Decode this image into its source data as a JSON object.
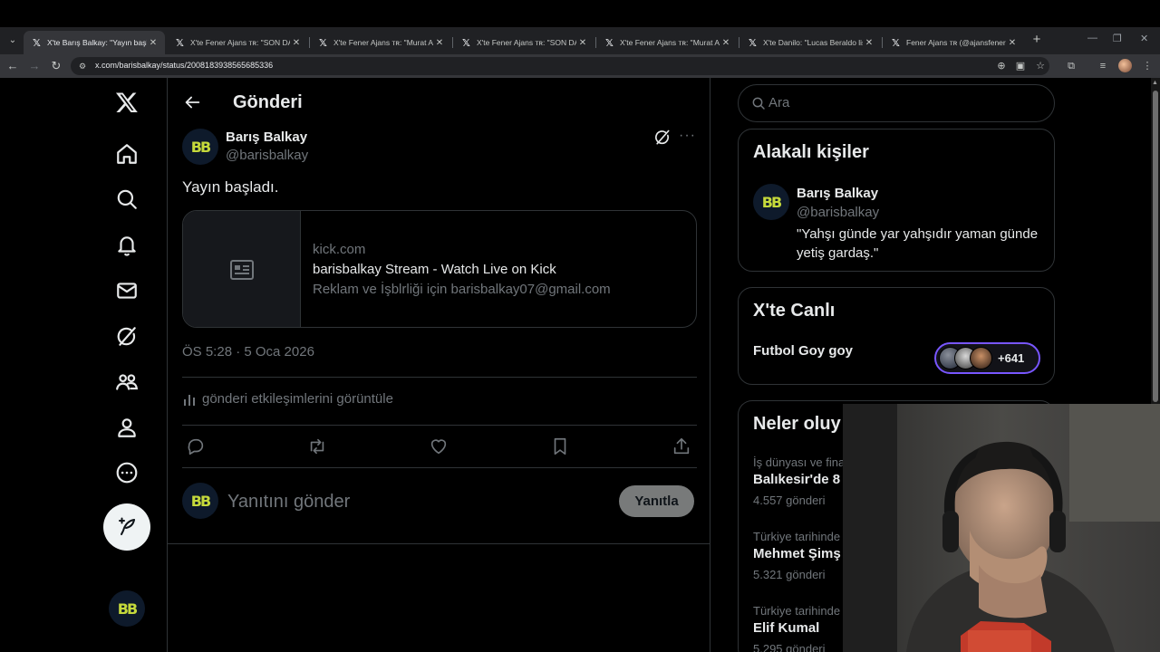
{
  "browser": {
    "tabs": [
      {
        "title": "X'te Barış Balkay: \"Yayın başladı\"",
        "active": true
      },
      {
        "title": "X'te Fener Ajans ᴛʀ: \"SON DAKİ…",
        "active": false
      },
      {
        "title": "X'te Fener Ajans ᴛʀ: \"Murat Aşık…",
        "active": false
      },
      {
        "title": "X'te Fener Ajans ᴛʀ: \"SON DAKİ…",
        "active": false
      },
      {
        "title": "X'te Fener Ajans ᴛʀ: \"Murat Aşık…",
        "active": false
      },
      {
        "title": "X'te Danilo: \"Lucas Beraldo liste…",
        "active": false
      },
      {
        "title": "Fener Ajans ᴛʀ (@ajansfenercom)…",
        "active": false
      }
    ],
    "url": "x.com/barisbalkay/status/2008183938565685336"
  },
  "post": {
    "header_title": "Gönderi",
    "author_name": "Barış Balkay",
    "author_handle": "@barisbalkay",
    "avatar_text": "BB",
    "text": "Yayın başladı.",
    "card": {
      "domain": "kick.com",
      "title": "barisbalkay Stream - Watch Live on Kick",
      "description": "Reklam ve İşblrliği için barisbalkay07@gmail.com"
    },
    "timestamp": "ÖS 5:28 · 5 Oca 2026",
    "analytics_label": "gönderi etkileşimlerini görüntüle",
    "reply_placeholder": "Yanıtını gönder",
    "reply_button": "Yanıtla"
  },
  "sidebar": {
    "search_placeholder": "Ara",
    "related": {
      "title": "Alakalı kişiler",
      "name": "Barış Balkay",
      "handle": "@barisbalkay",
      "bio": "\"Yahşı günde yar yahşıdır yaman günde yetiş gardaş.\""
    },
    "live": {
      "title": "X'te Canlı",
      "space_name": "Futbol Goy goy",
      "listener_count": "+641"
    },
    "trends": {
      "title": "Neler oluy",
      "items": [
        {
          "category": "İş dünyası ve fina",
          "name": "Balıkesir'de 8",
          "count": "4.557 gönderi"
        },
        {
          "category": "Türkiye tarihinde",
          "name": "Mehmet Şimş",
          "count": "5.321 gönderi"
        },
        {
          "category": "Türkiye tarihinde",
          "name": "Elif Kumal",
          "count": "5.295 gönderi"
        }
      ]
    }
  },
  "colors": {
    "background": "#000000",
    "border": "#2f3336",
    "secondary_text": "#71767b",
    "live_accent": "#7856ff",
    "avatar_logo": "#c5d93b"
  },
  "icons": [
    "x-logo-icon",
    "home-icon",
    "search-icon",
    "bell-icon",
    "mail-icon",
    "grok-icon",
    "communities-icon",
    "profile-icon",
    "more-circle-icon",
    "compose-icon",
    "back-arrow-icon",
    "more-icon",
    "article-icon",
    "analytics-icon",
    "reply-icon",
    "repost-icon",
    "like-icon",
    "bookmark-icon",
    "share-icon"
  ]
}
